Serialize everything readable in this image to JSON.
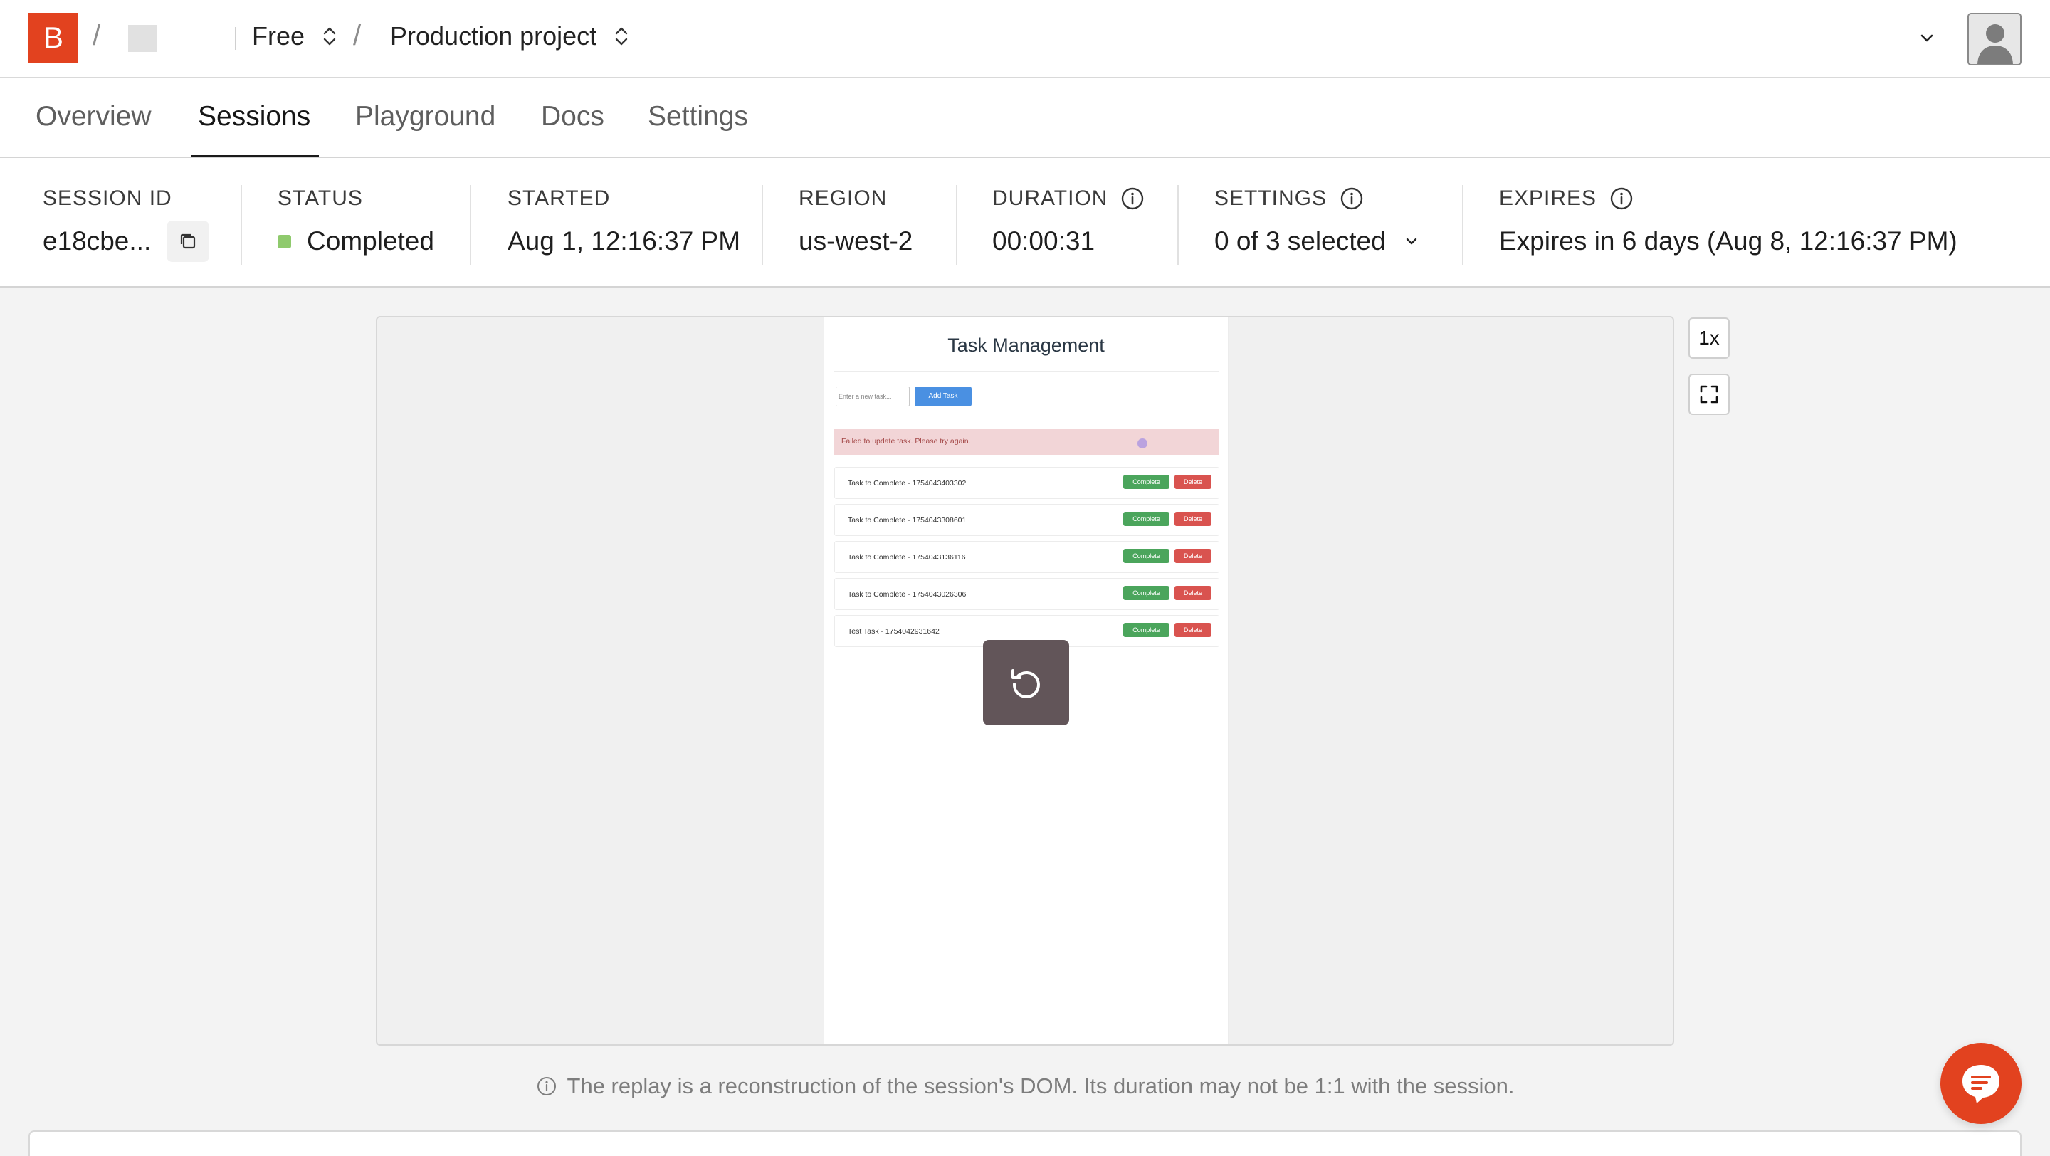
{
  "header": {
    "logo_letter": "B",
    "separator": "/",
    "plan_label": "Free",
    "project_label": "Production project",
    "brand_color": "#e2421f"
  },
  "tabs": [
    {
      "label": "Overview"
    },
    {
      "label": "Sessions",
      "active": true
    },
    {
      "label": "Playground"
    },
    {
      "label": "Docs"
    },
    {
      "label": "Settings"
    }
  ],
  "session": {
    "id_label": "SESSION ID",
    "id_value": "e18cbe...",
    "status_label": "STATUS",
    "status_value": "Completed",
    "status_color": "#8fca6d",
    "started_label": "STARTED",
    "started_value": "Aug 1, 12:16:37 PM",
    "region_label": "REGION",
    "region_value": "us-west-2",
    "duration_label": "DURATION",
    "duration_value": "00:00:31",
    "settings_label": "SETTINGS",
    "settings_value": "0 of 3 selected",
    "expires_label": "EXPIRES",
    "expires_value": "Expires in 6 days (Aug 8, 12:16:37 PM)"
  },
  "replay": {
    "app_title": "Task Management",
    "input_placeholder": "Enter a new task...",
    "add_button": "Add Task",
    "error_message": "Failed to update task. Please try again.",
    "complete_label": "Complete",
    "delete_label": "Delete",
    "tasks": [
      {
        "name": "Task to Complete - 1754043403302"
      },
      {
        "name": "Task to Complete - 1754043308601"
      },
      {
        "name": "Task to Complete - 1754043136116"
      },
      {
        "name": "Task to Complete - 1754043026306"
      },
      {
        "name": "Test Task - 1754042931642"
      }
    ],
    "speed_label": "1x"
  },
  "footer_note": "The replay is a reconstruction of the session's DOM. Its duration may not be 1:1 with the session."
}
